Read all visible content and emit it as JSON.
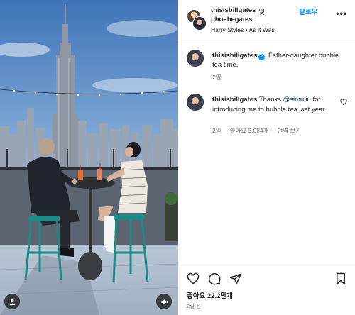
{
  "header": {
    "username": "thisisbillgates",
    "conjunction": "및",
    "collaborator": "phoebegates",
    "follow_label": "팔로우",
    "more_label": "•••",
    "audio": "Harry Styles • As It Was"
  },
  "caption": {
    "username": "thisisbillgates",
    "text": "Father-daughter bubble tea time.",
    "time": "2일"
  },
  "comment": {
    "username": "thisisbillgates",
    "prefix": "Thanks ",
    "mention": "@simuliu",
    "suffix": " for introducing me to bubble tea last year.",
    "time": "2일",
    "likes": "좋아요 3,084개",
    "see_translation": "번역 보기"
  },
  "footer": {
    "likes": "좋아요 22.2만개",
    "time_ago": "2일 전"
  },
  "icons": {
    "like": "heart-icon",
    "comment": "comment-icon",
    "share": "share-icon",
    "save": "bookmark-icon",
    "mute": "mute-icon",
    "user_tag": "user-icon"
  },
  "colors": {
    "link_blue": "#0095f6",
    "text": "#262626",
    "secondary": "#737373",
    "mention": "#00376b"
  }
}
